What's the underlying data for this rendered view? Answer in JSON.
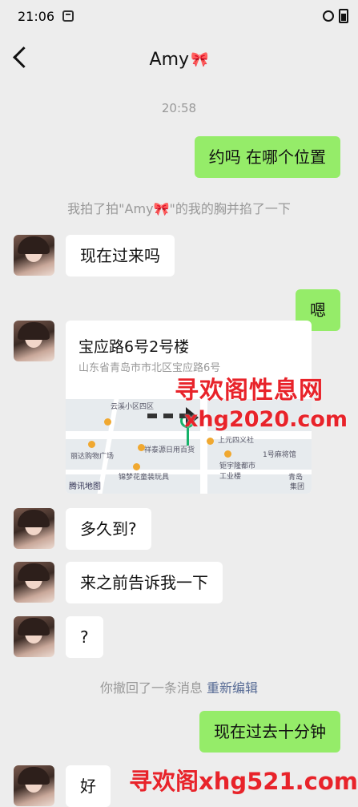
{
  "status_bar": {
    "time": "21:06"
  },
  "nav": {
    "title": "Amy"
  },
  "chat": {
    "timestamp": "20:58",
    "messages": {
      "m1": "约吗 在哪个位置",
      "m2": "现在过来吗",
      "m3": "嗯",
      "m4": "多久到?",
      "m5": "来之前告诉我一下",
      "m6": "?",
      "m7": "现在过去十分钟",
      "m8": "好"
    },
    "pat_notice": "我拍了拍\"Amy🎀\"的我的胸并掐了一下",
    "recall_notice": "你撤回了一条消息",
    "recall_edit": "重新编辑",
    "location": {
      "title": "宝应路6号2号楼",
      "address": "山东省青岛市市北区宝应路6号",
      "map_labels": [
        "云溪小区四区",
        "上元四义社",
        "祥泰源日用百货",
        "丽达购物广场",
        "1号麻将馆",
        "钜宇隆都市工业楼",
        "锦梦花童装玩具",
        "青岛",
        "集团"
      ],
      "map_provider": "腾讯地图"
    }
  },
  "watermarks": {
    "w1": "寻欢阁性息网",
    "w2": "xhg2020.com",
    "w3": "寻欢阁xhg521.com"
  }
}
